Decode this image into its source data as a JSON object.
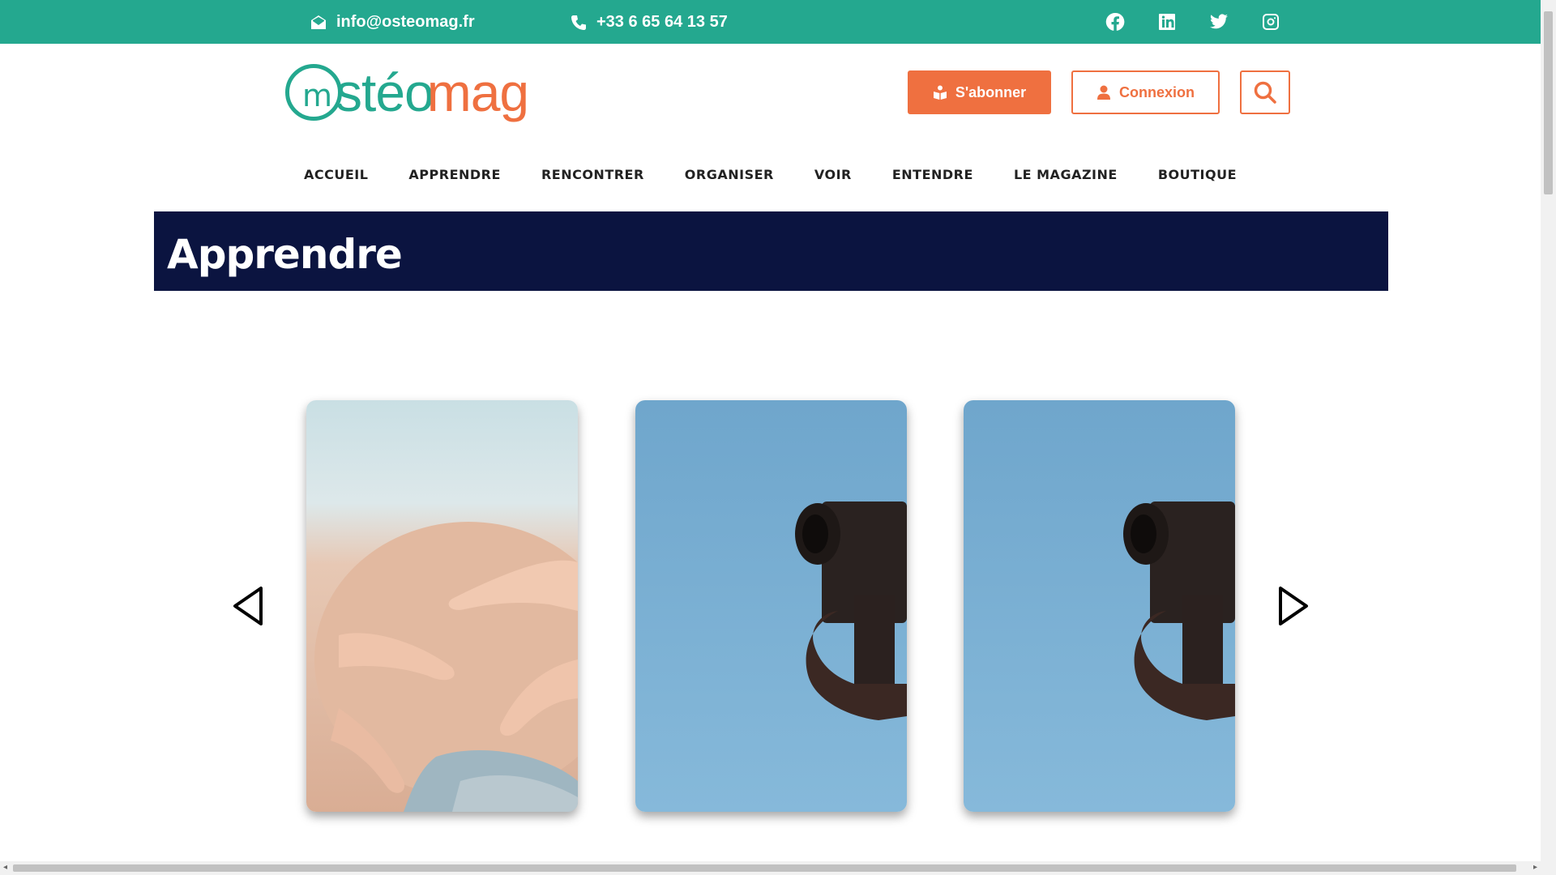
{
  "topbar": {
    "email": "info@osteomag.fr",
    "phone": "+33 6 65 64 13 57",
    "socials": [
      "facebook-icon",
      "linkedin-icon",
      "twitter-icon",
      "instagram-icon"
    ],
    "color": "#24a88f"
  },
  "logo": {
    "part1": "stéo",
    "part2": "mag",
    "mark": "m"
  },
  "header": {
    "subscribe_label": "S'abonner",
    "login_label": "Connexion",
    "accent": "#ef7040"
  },
  "nav": {
    "items": [
      "ACCUEIL",
      "APPRENDRE",
      "RENCONTRER",
      "ORGANISER",
      "VOIR",
      "ENTENDRE",
      "LE MAGAZINE",
      "BOUTIQUE"
    ]
  },
  "page": {
    "title": "Apprendre",
    "banner_color": "#0b1440"
  },
  "carousel": {
    "cards": [
      {
        "image": "massage-photo"
      },
      {
        "image": "camera-photo"
      },
      {
        "image": "camera-photo"
      }
    ]
  }
}
